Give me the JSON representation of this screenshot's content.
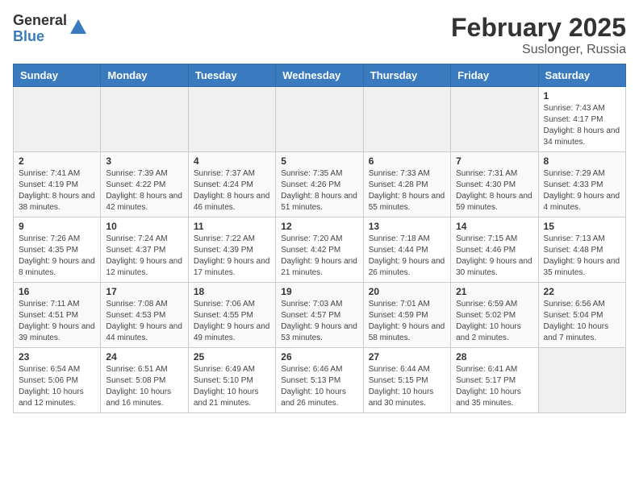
{
  "header": {
    "logo": {
      "general": "General",
      "blue": "Blue"
    },
    "month_year": "February 2025",
    "location": "Suslonger, Russia"
  },
  "weekdays": [
    "Sunday",
    "Monday",
    "Tuesday",
    "Wednesday",
    "Thursday",
    "Friday",
    "Saturday"
  ],
  "weeks": [
    [
      {
        "day": "",
        "info": ""
      },
      {
        "day": "",
        "info": ""
      },
      {
        "day": "",
        "info": ""
      },
      {
        "day": "",
        "info": ""
      },
      {
        "day": "",
        "info": ""
      },
      {
        "day": "",
        "info": ""
      },
      {
        "day": "1",
        "info": "Sunrise: 7:43 AM\nSunset: 4:17 PM\nDaylight: 8 hours and 34 minutes."
      }
    ],
    [
      {
        "day": "2",
        "info": "Sunrise: 7:41 AM\nSunset: 4:19 PM\nDaylight: 8 hours and 38 minutes."
      },
      {
        "day": "3",
        "info": "Sunrise: 7:39 AM\nSunset: 4:22 PM\nDaylight: 8 hours and 42 minutes."
      },
      {
        "day": "4",
        "info": "Sunrise: 7:37 AM\nSunset: 4:24 PM\nDaylight: 8 hours and 46 minutes."
      },
      {
        "day": "5",
        "info": "Sunrise: 7:35 AM\nSunset: 4:26 PM\nDaylight: 8 hours and 51 minutes."
      },
      {
        "day": "6",
        "info": "Sunrise: 7:33 AM\nSunset: 4:28 PM\nDaylight: 8 hours and 55 minutes."
      },
      {
        "day": "7",
        "info": "Sunrise: 7:31 AM\nSunset: 4:30 PM\nDaylight: 8 hours and 59 minutes."
      },
      {
        "day": "8",
        "info": "Sunrise: 7:29 AM\nSunset: 4:33 PM\nDaylight: 9 hours and 4 minutes."
      }
    ],
    [
      {
        "day": "9",
        "info": "Sunrise: 7:26 AM\nSunset: 4:35 PM\nDaylight: 9 hours and 8 minutes."
      },
      {
        "day": "10",
        "info": "Sunrise: 7:24 AM\nSunset: 4:37 PM\nDaylight: 9 hours and 12 minutes."
      },
      {
        "day": "11",
        "info": "Sunrise: 7:22 AM\nSunset: 4:39 PM\nDaylight: 9 hours and 17 minutes."
      },
      {
        "day": "12",
        "info": "Sunrise: 7:20 AM\nSunset: 4:42 PM\nDaylight: 9 hours and 21 minutes."
      },
      {
        "day": "13",
        "info": "Sunrise: 7:18 AM\nSunset: 4:44 PM\nDaylight: 9 hours and 26 minutes."
      },
      {
        "day": "14",
        "info": "Sunrise: 7:15 AM\nSunset: 4:46 PM\nDaylight: 9 hours and 30 minutes."
      },
      {
        "day": "15",
        "info": "Sunrise: 7:13 AM\nSunset: 4:48 PM\nDaylight: 9 hours and 35 minutes."
      }
    ],
    [
      {
        "day": "16",
        "info": "Sunrise: 7:11 AM\nSunset: 4:51 PM\nDaylight: 9 hours and 39 minutes."
      },
      {
        "day": "17",
        "info": "Sunrise: 7:08 AM\nSunset: 4:53 PM\nDaylight: 9 hours and 44 minutes."
      },
      {
        "day": "18",
        "info": "Sunrise: 7:06 AM\nSunset: 4:55 PM\nDaylight: 9 hours and 49 minutes."
      },
      {
        "day": "19",
        "info": "Sunrise: 7:03 AM\nSunset: 4:57 PM\nDaylight: 9 hours and 53 minutes."
      },
      {
        "day": "20",
        "info": "Sunrise: 7:01 AM\nSunset: 4:59 PM\nDaylight: 9 hours and 58 minutes."
      },
      {
        "day": "21",
        "info": "Sunrise: 6:59 AM\nSunset: 5:02 PM\nDaylight: 10 hours and 2 minutes."
      },
      {
        "day": "22",
        "info": "Sunrise: 6:56 AM\nSunset: 5:04 PM\nDaylight: 10 hours and 7 minutes."
      }
    ],
    [
      {
        "day": "23",
        "info": "Sunrise: 6:54 AM\nSunset: 5:06 PM\nDaylight: 10 hours and 12 minutes."
      },
      {
        "day": "24",
        "info": "Sunrise: 6:51 AM\nSunset: 5:08 PM\nDaylight: 10 hours and 16 minutes."
      },
      {
        "day": "25",
        "info": "Sunrise: 6:49 AM\nSunset: 5:10 PM\nDaylight: 10 hours and 21 minutes."
      },
      {
        "day": "26",
        "info": "Sunrise: 6:46 AM\nSunset: 5:13 PM\nDaylight: 10 hours and 26 minutes."
      },
      {
        "day": "27",
        "info": "Sunrise: 6:44 AM\nSunset: 5:15 PM\nDaylight: 10 hours and 30 minutes."
      },
      {
        "day": "28",
        "info": "Sunrise: 6:41 AM\nSunset: 5:17 PM\nDaylight: 10 hours and 35 minutes."
      },
      {
        "day": "",
        "info": ""
      }
    ]
  ]
}
